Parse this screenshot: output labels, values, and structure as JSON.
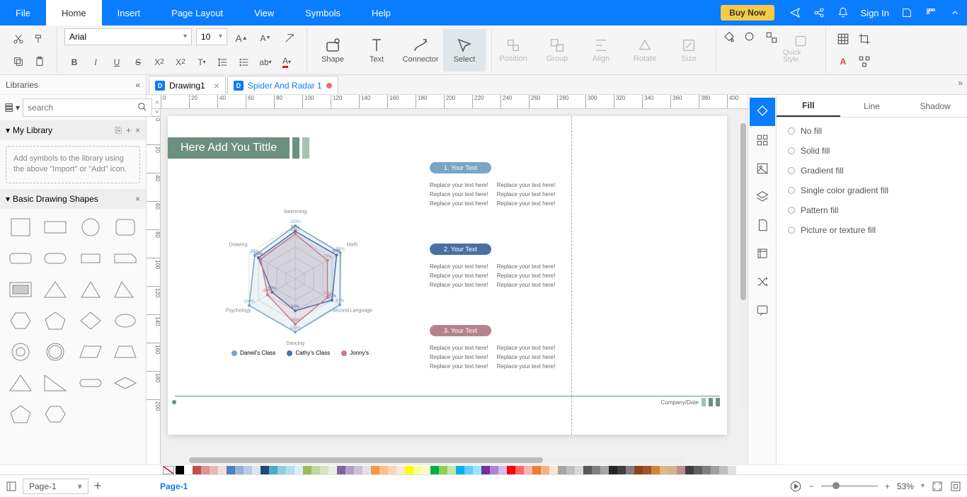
{
  "menu": {
    "items": [
      "File",
      "Home",
      "Insert",
      "Page Layout",
      "View",
      "Symbols",
      "Help"
    ],
    "active": "Home",
    "buy": "Buy Now",
    "signin": "Sign In"
  },
  "ribbon": {
    "font_name": "Arial",
    "font_size": "10",
    "tools": {
      "shape": "Shape",
      "text": "Text",
      "connector": "Connector",
      "select": "Select"
    },
    "arrange": {
      "position": "Position",
      "group": "Group",
      "align": "Align",
      "rotate": "Rotate",
      "size": "Size"
    },
    "quick_style": "Quick Style"
  },
  "tabs": [
    {
      "name": "Drawing1",
      "active": false,
      "unsaved": false
    },
    {
      "name": "Spider And Radar 1",
      "active": true,
      "unsaved": true
    }
  ],
  "libraries": {
    "title": "Libraries",
    "search_placeholder": "search",
    "my_library": "My Library",
    "placeholder_text": "Add symbols to the library using the above \"Import\" or \"Add\" icon.",
    "basic_shapes": "Basic Drawing Shapes"
  },
  "canvas": {
    "title": "Here Add You Tittle",
    "sections": [
      {
        "pill": "1.  Your Text",
        "pill_class": "pill-1"
      },
      {
        "pill": "2.  Your Text",
        "pill_class": "pill-2"
      },
      {
        "pill": "3.  Your Text",
        "pill_class": "pill-3"
      }
    ],
    "placeholder": "Replace your text here!",
    "footer": "Company/Date"
  },
  "chart_data": {
    "type": "radar",
    "categories": [
      "Swimming",
      "Math",
      "Second Language",
      "Dancing",
      "Psychology",
      "Drawing"
    ],
    "series": [
      {
        "name": "Daneil's Class",
        "color": "#7aa5c4",
        "values": [
          100,
          98,
          97,
          100,
          100,
          88
        ]
      },
      {
        "name": "Cathy's Class",
        "color": "#4a6fa5",
        "values": [
          90,
          90,
          80,
          60,
          50,
          80
        ]
      },
      {
        "name": "Jonny's",
        "color": "#c97b84",
        "values": [
          85,
          70,
          70,
          85,
          60,
          75
        ]
      }
    ],
    "range": [
      0,
      100
    ]
  },
  "right_panel": {
    "tabs": [
      "Fill",
      "Line",
      "Shadow"
    ],
    "active_tab": "Fill",
    "options": [
      "No fill",
      "Solid fill",
      "Gradient fill",
      "Single color gradient fill",
      "Pattern fill",
      "Picture or texture fill"
    ]
  },
  "colors": [
    "#000000",
    "#ffffff",
    "#c0504d",
    "#d99694",
    "#e6b9b8",
    "#f2dcdb",
    "#4f81bd",
    "#95b3d7",
    "#b8cce4",
    "#dce6f1",
    "#1f497d",
    "#4bacc6",
    "#93cddd",
    "#b7dee8",
    "#daeef3",
    "#9bbb59",
    "#c3d69b",
    "#d7e4bc",
    "#ebf1de",
    "#8064a2",
    "#b2a1c7",
    "#ccc0d9",
    "#e5dfec",
    "#f79646",
    "#fac090",
    "#fcd5b4",
    "#fde9d9",
    "#ffff00",
    "#ffff99",
    "#ffffcc",
    "#00b050",
    "#92d050",
    "#c3e6a0",
    "#00b0f0",
    "#66ccff",
    "#99e6ff",
    "#7030a0",
    "#b085d8",
    "#d4bceb",
    "#ff0000",
    "#ff6666",
    "#ffb3b3",
    "#ed7d31",
    "#f4b183",
    "#fbe5d6",
    "#a5a5a5",
    "#bfbfbf",
    "#d9d9d9",
    "#595959",
    "#808080",
    "#a6a6a6",
    "#262626",
    "#404040",
    "#7f7f7f",
    "#8b4513",
    "#a0522d",
    "#cd853f",
    "#deb887",
    "#d2b48c",
    "#bc8f8f",
    "#404040",
    "#606060",
    "#808080",
    "#a0a0a0",
    "#c0c0c0",
    "#e0e0e0"
  ],
  "status": {
    "page_selector": "Page-1",
    "page_tab": "Page-1",
    "zoom": "53%"
  },
  "ruler_ticks": [
    0,
    20,
    40,
    60,
    80,
    100,
    120,
    140,
    160,
    180,
    200,
    220,
    240,
    260,
    280,
    300,
    320,
    340,
    360,
    380,
    400
  ]
}
